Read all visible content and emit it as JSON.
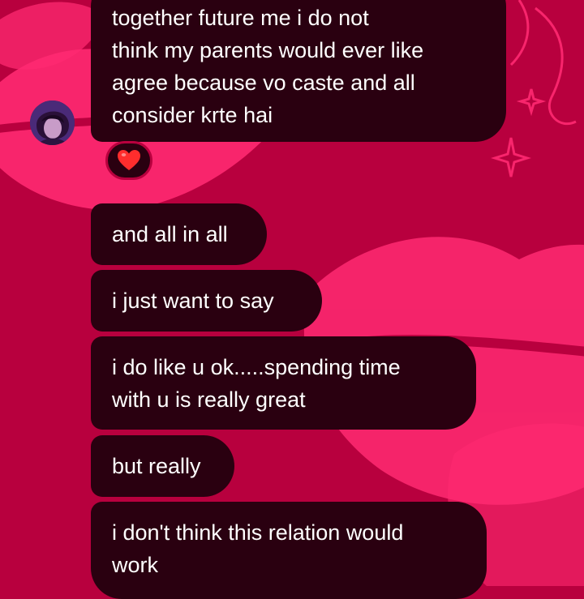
{
  "theme": {
    "background": "#b8003e",
    "lips_color": "#ff2a72",
    "bubble_color": "#2a0010",
    "text_color": "#ffffff",
    "heart_color": "#ff2d2d"
  },
  "chat": {
    "contact_avatar_icon": "avatar-photo",
    "messages": [
      {
        "text": "together future me i do not\nthink my parents would ever like\nagree because vo caste and all\nconsider krte hai"
      },
      {
        "text": "and all in all"
      },
      {
        "text": "i just want to say"
      },
      {
        "text": "i do like u ok.....spending time\nwith u is really great"
      },
      {
        "text": "but really"
      },
      {
        "text": "i don't think this relation would\nwork"
      }
    ],
    "reaction": {
      "emoji_name": "red-heart-icon"
    }
  }
}
